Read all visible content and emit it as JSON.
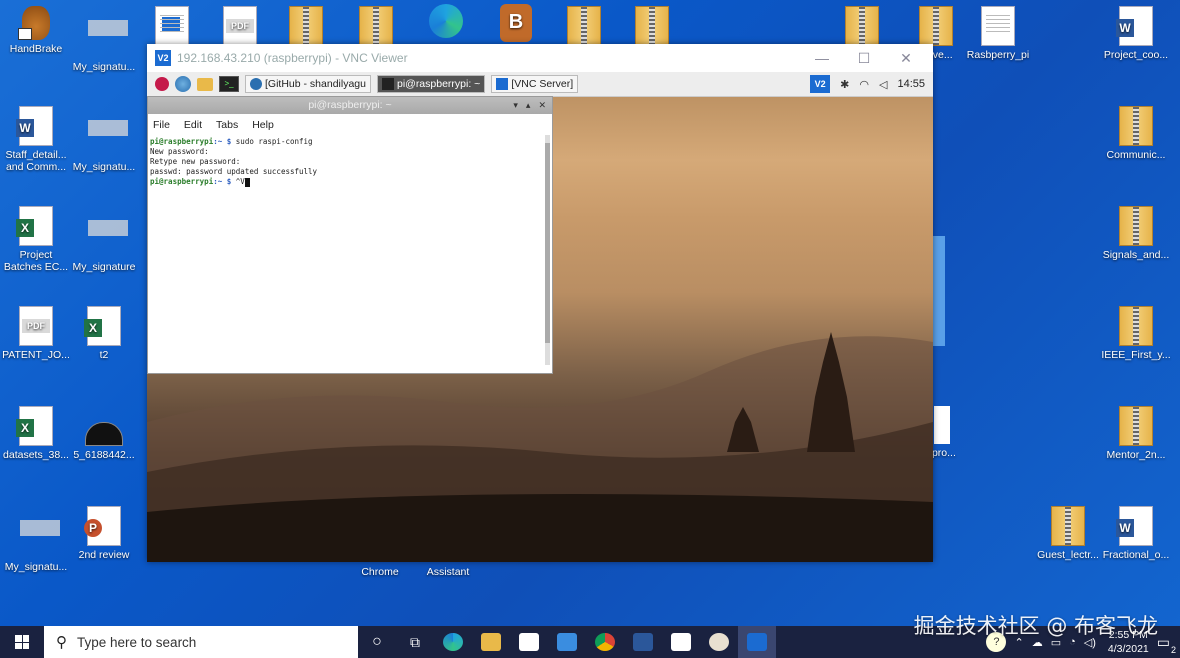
{
  "desktop": {
    "icons": [
      {
        "label": "HandBrake",
        "kind": "pineapple"
      },
      {
        "label": "My_signatu...",
        "kind": "sig"
      },
      {
        "label": "",
        "kind": "video"
      },
      {
        "label": "",
        "kind": "pdf"
      },
      {
        "label": "",
        "kind": "folder"
      },
      {
        "label": "",
        "kind": "doc"
      },
      {
        "label": "",
        "kind": "edge"
      },
      {
        "label": "",
        "kind": "bitrix"
      },
      {
        "label": "",
        "kind": "doc"
      },
      {
        "label": "",
        "kind": "doc"
      },
      {
        "label": "",
        "kind": "pdf"
      },
      {
        "label": "wave...",
        "kind": "doc"
      },
      {
        "label": "Rasbperry_pi",
        "kind": "doc"
      },
      {
        "label": "Project_coo...",
        "kind": "word"
      },
      {
        "label": "Staff_detail... and Comm...",
        "kind": "word"
      },
      {
        "label": "My_signatu...",
        "kind": "sig"
      },
      {
        "label": "Communic...",
        "kind": "archive"
      },
      {
        "label": "Project Batches EC...",
        "kind": "excel"
      },
      {
        "label": "My_signature",
        "kind": "sig"
      },
      {
        "label": "Signals_and...",
        "kind": "archive"
      },
      {
        "label": "PATENT_JO...",
        "kind": "pdf"
      },
      {
        "label": "t2",
        "kind": "excel"
      },
      {
        "label": "IEEE_First_y...",
        "kind": "archive"
      },
      {
        "label": "datasets_38...",
        "kind": "excel-a"
      },
      {
        "label": "5_6188442...",
        "kind": "photo"
      },
      {
        "label": "_pro...",
        "kind": "partial"
      },
      {
        "label": "Mentor_2n...",
        "kind": "archive"
      },
      {
        "label": "My_signatu...",
        "kind": "sig"
      },
      {
        "label": "2nd review",
        "kind": "ppt"
      },
      {
        "label": "Chrome",
        "kind": "hidden"
      },
      {
        "label": "Assistant",
        "kind": "hidden"
      },
      {
        "label": "Guest_lectr...",
        "kind": "archive"
      },
      {
        "label": "Fractional_o...",
        "kind": "word"
      }
    ]
  },
  "vnc": {
    "title": "192.168.43.210 (raspberrypi) - VNC Viewer",
    "controls": {
      "min": "—",
      "max": "☐",
      "close": "✕"
    },
    "panel": {
      "tabs": [
        {
          "label": "[GitHub - shandilyagu",
          "active": false
        },
        {
          "label": "pi@raspberrypi: ~",
          "active": true
        },
        {
          "label": "[VNC Server]",
          "active": false
        }
      ],
      "clock": "14:55"
    },
    "terminal": {
      "title": "pi@raspberrypi: ~",
      "menu": [
        "File",
        "Edit",
        "Tabs",
        "Help"
      ],
      "lines": [
        {
          "prompt": "pi@raspberrypi",
          "path": ":~ $ ",
          "text": "sudo raspi-config"
        },
        {
          "prompt": "",
          "path": "",
          "text": "New password:"
        },
        {
          "prompt": "",
          "path": "",
          "text": "Retype new password:"
        },
        {
          "prompt": "",
          "path": "",
          "text": "passwd: password updated successfully"
        },
        {
          "prompt": "pi@raspberrypi",
          "path": ":~ $ ",
          "text": "^V"
        }
      ]
    }
  },
  "taskbar": {
    "search_placeholder": "Type here to search",
    "time": "2:55 PM",
    "date": "4/3/2021",
    "notification_count": "2"
  },
  "watermark": "掘金技术社区 @ 布客飞龙"
}
